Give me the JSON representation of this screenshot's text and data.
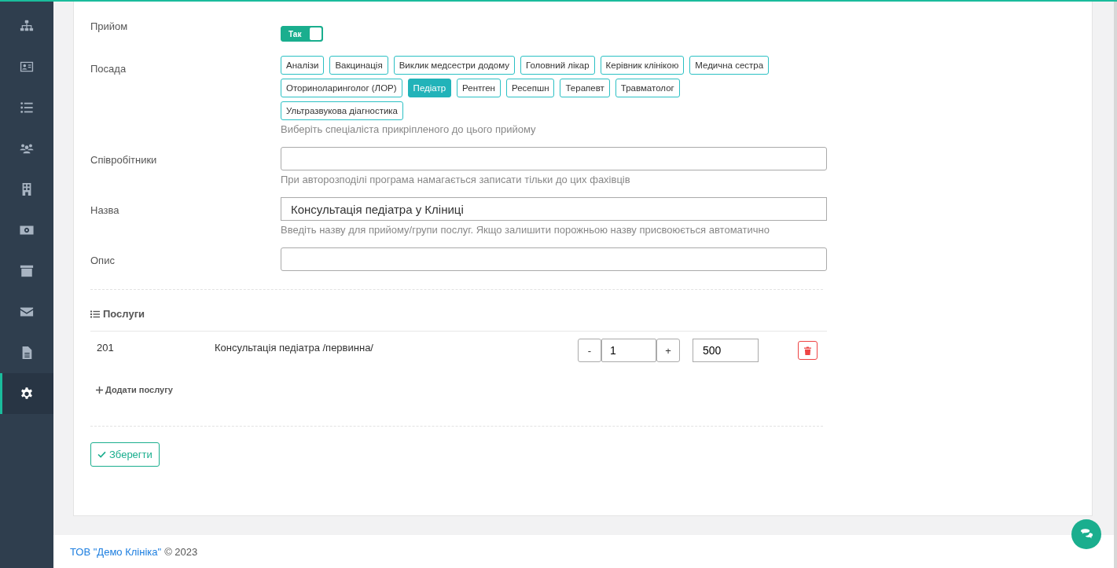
{
  "sidebar": {
    "items": [
      {
        "selected": false
      },
      {
        "selected": false
      },
      {
        "selected": false
      },
      {
        "selected": false
      },
      {
        "selected": false
      },
      {
        "selected": false
      },
      {
        "selected": false
      },
      {
        "selected": false
      },
      {
        "selected": false
      },
      {
        "selected": true
      }
    ]
  },
  "reception": {
    "label": "Прийом",
    "toggle_text": "Так",
    "on": true
  },
  "position": {
    "label": "Посада",
    "options": [
      {
        "label": "Аналізи",
        "selected": false
      },
      {
        "label": "Вакцинація",
        "selected": false
      },
      {
        "label": "Виклик медсестри додому",
        "selected": false
      },
      {
        "label": "Головний лікар",
        "selected": false
      },
      {
        "label": "Керівник клінікою",
        "selected": false
      },
      {
        "label": "Медична сестра",
        "selected": false
      },
      {
        "label": "Оториноларинголог (ЛОР)",
        "selected": false
      },
      {
        "label": "Педіатр",
        "selected": true
      },
      {
        "label": "Рентген",
        "selected": false
      },
      {
        "label": "Ресепшн",
        "selected": false
      },
      {
        "label": "Терапевт",
        "selected": false
      },
      {
        "label": "Травматолог",
        "selected": false
      },
      {
        "label": "Ультразвукова діагностика",
        "selected": false
      }
    ],
    "hint": "Виберіть спеціаліста прикріпленого до цього прийому"
  },
  "employees": {
    "label": "Співробітники",
    "hint": "При авторозподілі програма намагається записати тільки до цих фахівців"
  },
  "name": {
    "label": "Назва",
    "value": "Консультація педіатра у Кліниці",
    "hint": "Введіть назву для прийому/групи послуг. Якщо залишити порожньою назву присвоюється автоматично"
  },
  "description": {
    "label": "Опис"
  },
  "services": {
    "title": "Послуги",
    "rows": [
      {
        "code": "201",
        "name": "Консультація педіатра /первинна/",
        "minus": "-",
        "quantity": "1",
        "plus": "+",
        "price": "500"
      }
    ],
    "add_label": "Додати послугу"
  },
  "save_label": "Зберегти",
  "footer": {
    "company": "ТОВ \"Демо Клініка\"",
    "copyright": "© 2023"
  }
}
